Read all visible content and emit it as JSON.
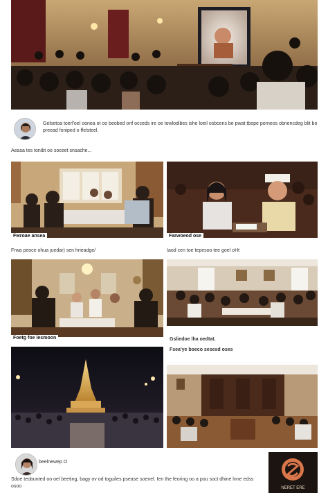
{
  "post": {
    "text": "Gelsetoa toerl'oel oonea ot oo beobed onf occeds ire oe towlodibes ishe loeil osbcens be pwat tbope porneos obnencdeg blit bo preead foniped o ffelsteel.",
    "subtext": "Aeasa tes tonibt oo soceet snsache..."
  },
  "captions": {
    "grid1": "Fwroae ansea",
    "grid2": "Farwoeod ose",
    "grid1_line": "Frwa peoce ohua juedar) sen hrieadge/",
    "grid2_line": "Iaod cen toe tepesoo tee goel oHt",
    "grid3": "Foetg foe lesmoon",
    "grid4_line1": "Gsliedoe lha oedtat.",
    "grid4_line2": "Fsea'ye boeco sesesd oses"
  },
  "footer": {
    "name": "beelnewep  O",
    "text": "Sdoe teobunted oo oel beeting, bagy ov od toguiles psease soenel. Ien the feoring oo a pou soct dhine lnne edss osoo",
    "logo_text": "NERET ERE"
  },
  "colors": {
    "page_bg": "#ffffff",
    "text": "#333333"
  }
}
